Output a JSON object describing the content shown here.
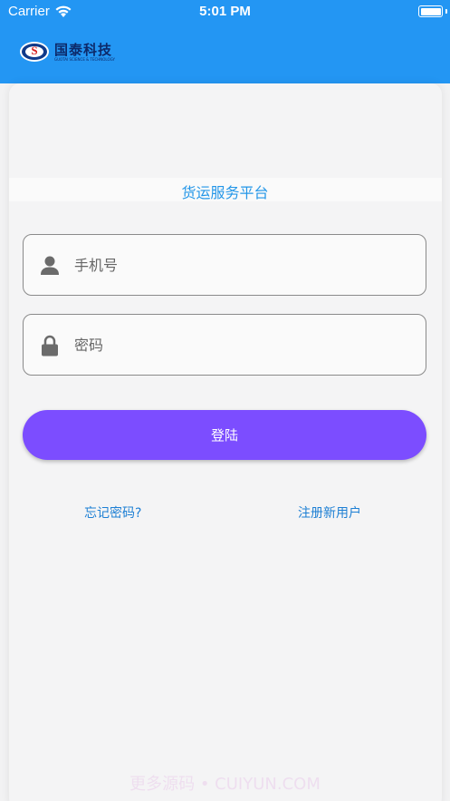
{
  "status_bar": {
    "carrier": "Carrier",
    "time": "5:01 PM",
    "battery_level": 1.0
  },
  "header": {
    "color": "#2396f3",
    "logo": {
      "mark": "S",
      "name": "国泰科技",
      "subtitle": "GUOTAI SCIENCE & TECHNOLOGY"
    }
  },
  "main": {
    "title": "货运服务平台",
    "phone_field": {
      "placeholder": "手机号",
      "value": "",
      "icon": "person-icon"
    },
    "password_field": {
      "placeholder": "密码",
      "value": "",
      "icon": "lock-icon"
    },
    "login_button": {
      "label": "登陆",
      "color": "#7c4dff"
    },
    "forgot_link": "忘记密码?",
    "register_link": "注册新用户"
  },
  "watermark": "更多源码 • CUIYUN.COM",
  "colors": {
    "accent": "#2396f3",
    "link": "#1d7fd4",
    "button": "#7c4dff"
  }
}
